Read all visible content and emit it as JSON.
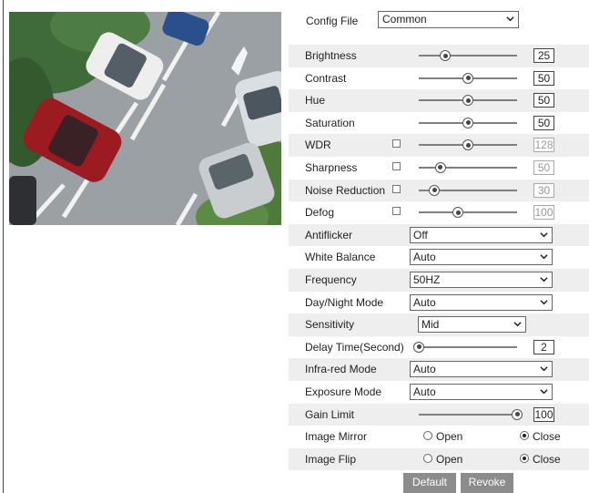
{
  "config_file": {
    "label": "Config File",
    "value": "Common"
  },
  "sliders": [
    {
      "label": "Brightness",
      "value": "25",
      "position": 0.27,
      "checkbox": false,
      "disabled": false
    },
    {
      "label": "Contrast",
      "value": "50",
      "position": 0.5,
      "checkbox": false,
      "disabled": false
    },
    {
      "label": "Hue",
      "value": "50",
      "position": 0.5,
      "checkbox": false,
      "disabled": false
    },
    {
      "label": "Saturation",
      "value": "50",
      "position": 0.5,
      "checkbox": false,
      "disabled": false
    },
    {
      "label": "WDR",
      "value": "128",
      "position": 0.5,
      "checkbox": true,
      "disabled": true
    },
    {
      "label": "Sharpness",
      "value": "50",
      "position": 0.22,
      "checkbox": true,
      "disabled": true
    },
    {
      "label": "Noise Reduction",
      "value": "30",
      "position": 0.16,
      "checkbox": true,
      "disabled": true
    },
    {
      "label": "Defog",
      "value": "100",
      "position": 0.4,
      "checkbox": true,
      "disabled": true
    }
  ],
  "selects": {
    "antiflicker": {
      "label": "Antiflicker",
      "value": "Off"
    },
    "white_balance": {
      "label": "White Balance",
      "value": "Auto"
    },
    "frequency": {
      "label": "Frequency",
      "value": "50HZ"
    },
    "day_night": {
      "label": "Day/Night Mode",
      "value": "Auto"
    },
    "sensitivity": {
      "label": "Sensitivity",
      "value": "Mid"
    }
  },
  "delay_time": {
    "label": "Delay Time(Second)",
    "value": "2",
    "position": 0.0
  },
  "infrared": {
    "label": "Infra-red Mode",
    "value": "Auto"
  },
  "exposure": {
    "label": "Exposure Mode",
    "value": "Auto"
  },
  "gain_limit": {
    "label": "Gain Limit",
    "value": "100",
    "position": 1.0
  },
  "image_mirror": {
    "label": "Image Mirror",
    "open": "Open",
    "close": "Close",
    "selected": "close"
  },
  "image_flip": {
    "label": "Image Flip",
    "open": "Open",
    "close": "Close",
    "selected": "close"
  },
  "buttons": {
    "default": "Default",
    "revoke": "Revoke"
  },
  "colors": {
    "row_shade": "#eeeeee",
    "button_bg": "#8c8c8c"
  },
  "icons": {
    "dropdown": "chevron-down-icon",
    "preview": "camera-preview-image"
  }
}
